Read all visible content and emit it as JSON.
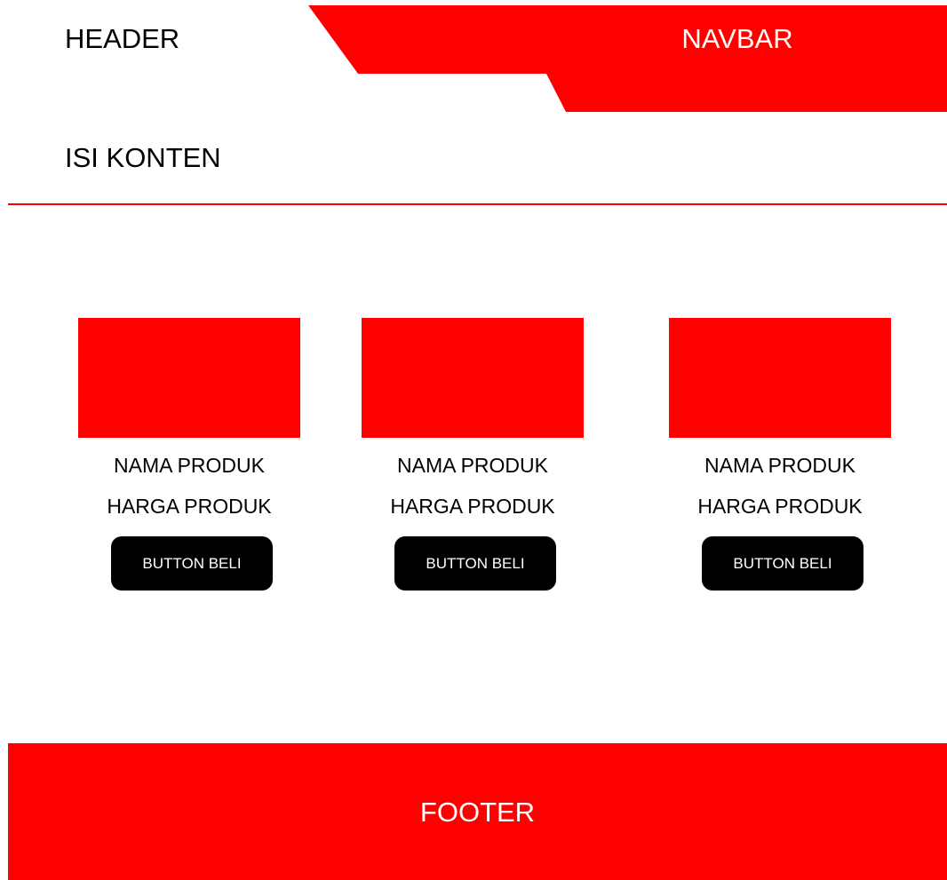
{
  "colors": {
    "accent": "#ff0000",
    "button": "#000000",
    "text": "#000000",
    "text_inverse": "#ffffff",
    "background": "#ffffff"
  },
  "header": {
    "label": "HEADER"
  },
  "navbar": {
    "label": "NAVBAR"
  },
  "content": {
    "title": "ISI KONTEN"
  },
  "products": [
    {
      "name": "NAMA PRODUK",
      "price": "HARGA PRODUK",
      "button_label": "BUTTON BELI"
    },
    {
      "name": "NAMA PRODUK",
      "price": "HARGA PRODUK",
      "button_label": "BUTTON BELI"
    },
    {
      "name": "NAMA PRODUK",
      "price": "HARGA PRODUK",
      "button_label": "BUTTON BELI"
    }
  ],
  "footer": {
    "label": "FOOTER"
  }
}
